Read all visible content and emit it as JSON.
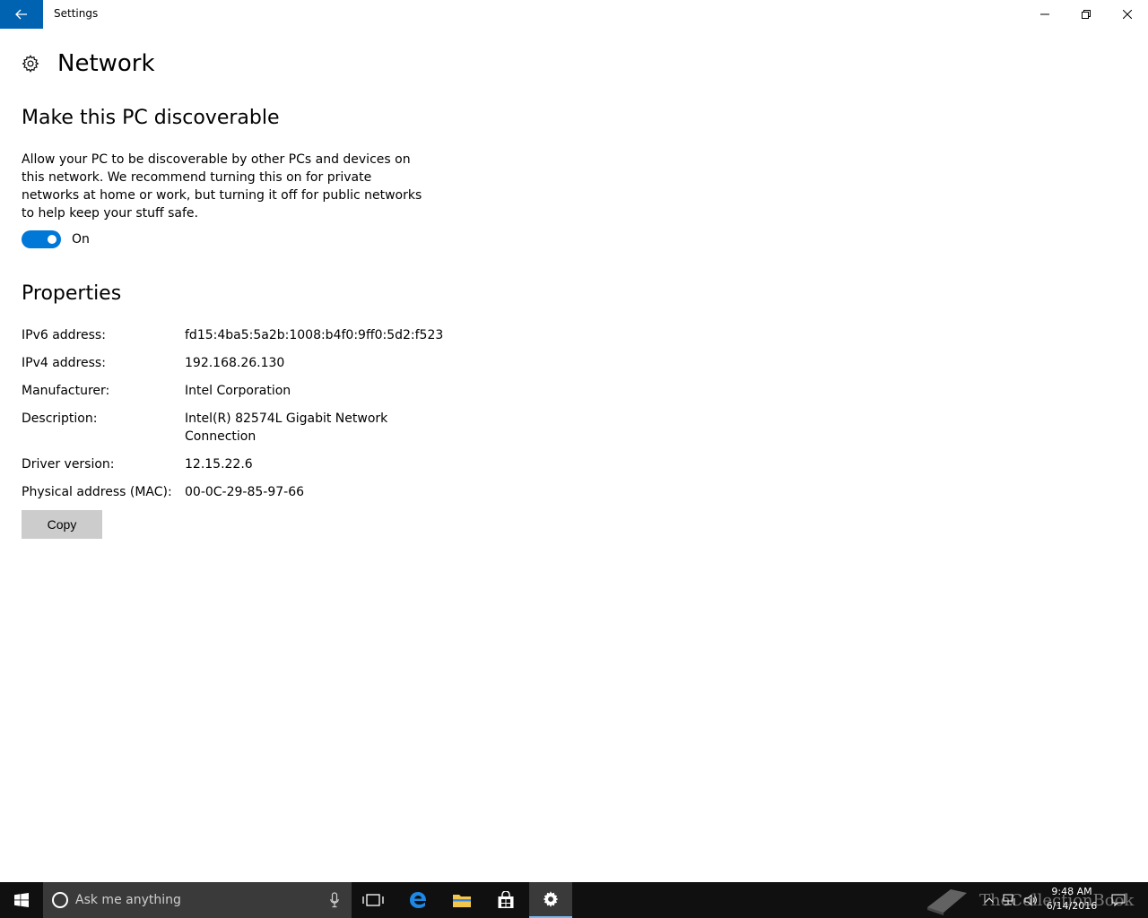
{
  "window": {
    "title": "Settings"
  },
  "page": {
    "title": "Network"
  },
  "discoverable": {
    "heading": "Make this PC discoverable",
    "description": "Allow your PC to be discoverable by other PCs and devices on this network. We recommend turning this on for private networks at home or work, but turning it off for public networks to help keep your stuff safe.",
    "toggle_state": "On",
    "toggle_color": "#0078d7"
  },
  "properties": {
    "heading": "Properties",
    "rows": [
      {
        "label": "IPv6 address:",
        "value": "fd15:4ba5:5a2b:1008:b4f0:9ff0:5d2:f523"
      },
      {
        "label": "IPv4 address:",
        "value": "192.168.26.130"
      },
      {
        "label": "Manufacturer:",
        "value": "Intel Corporation"
      },
      {
        "label": "Description:",
        "value": "Intel(R) 82574L Gigabit Network Connection"
      },
      {
        "label": "Driver version:",
        "value": "12.15.22.6"
      },
      {
        "label": "Physical address (MAC):",
        "value": "00-0C-29-85-97-66"
      }
    ],
    "copy_label": "Copy"
  },
  "taskbar": {
    "search_placeholder": "Ask me anything",
    "time": "9:48 AM",
    "date": "6/14/2016",
    "watermark": "TheCollectionBook",
    "icons": [
      "windows-start-icon",
      "task-view-icon",
      "edge-icon",
      "file-explorer-icon",
      "store-icon",
      "settings-icon"
    ]
  },
  "colors": {
    "accent": "#0063b1",
    "toggle": "#0078d7",
    "taskbar": "#101010"
  }
}
